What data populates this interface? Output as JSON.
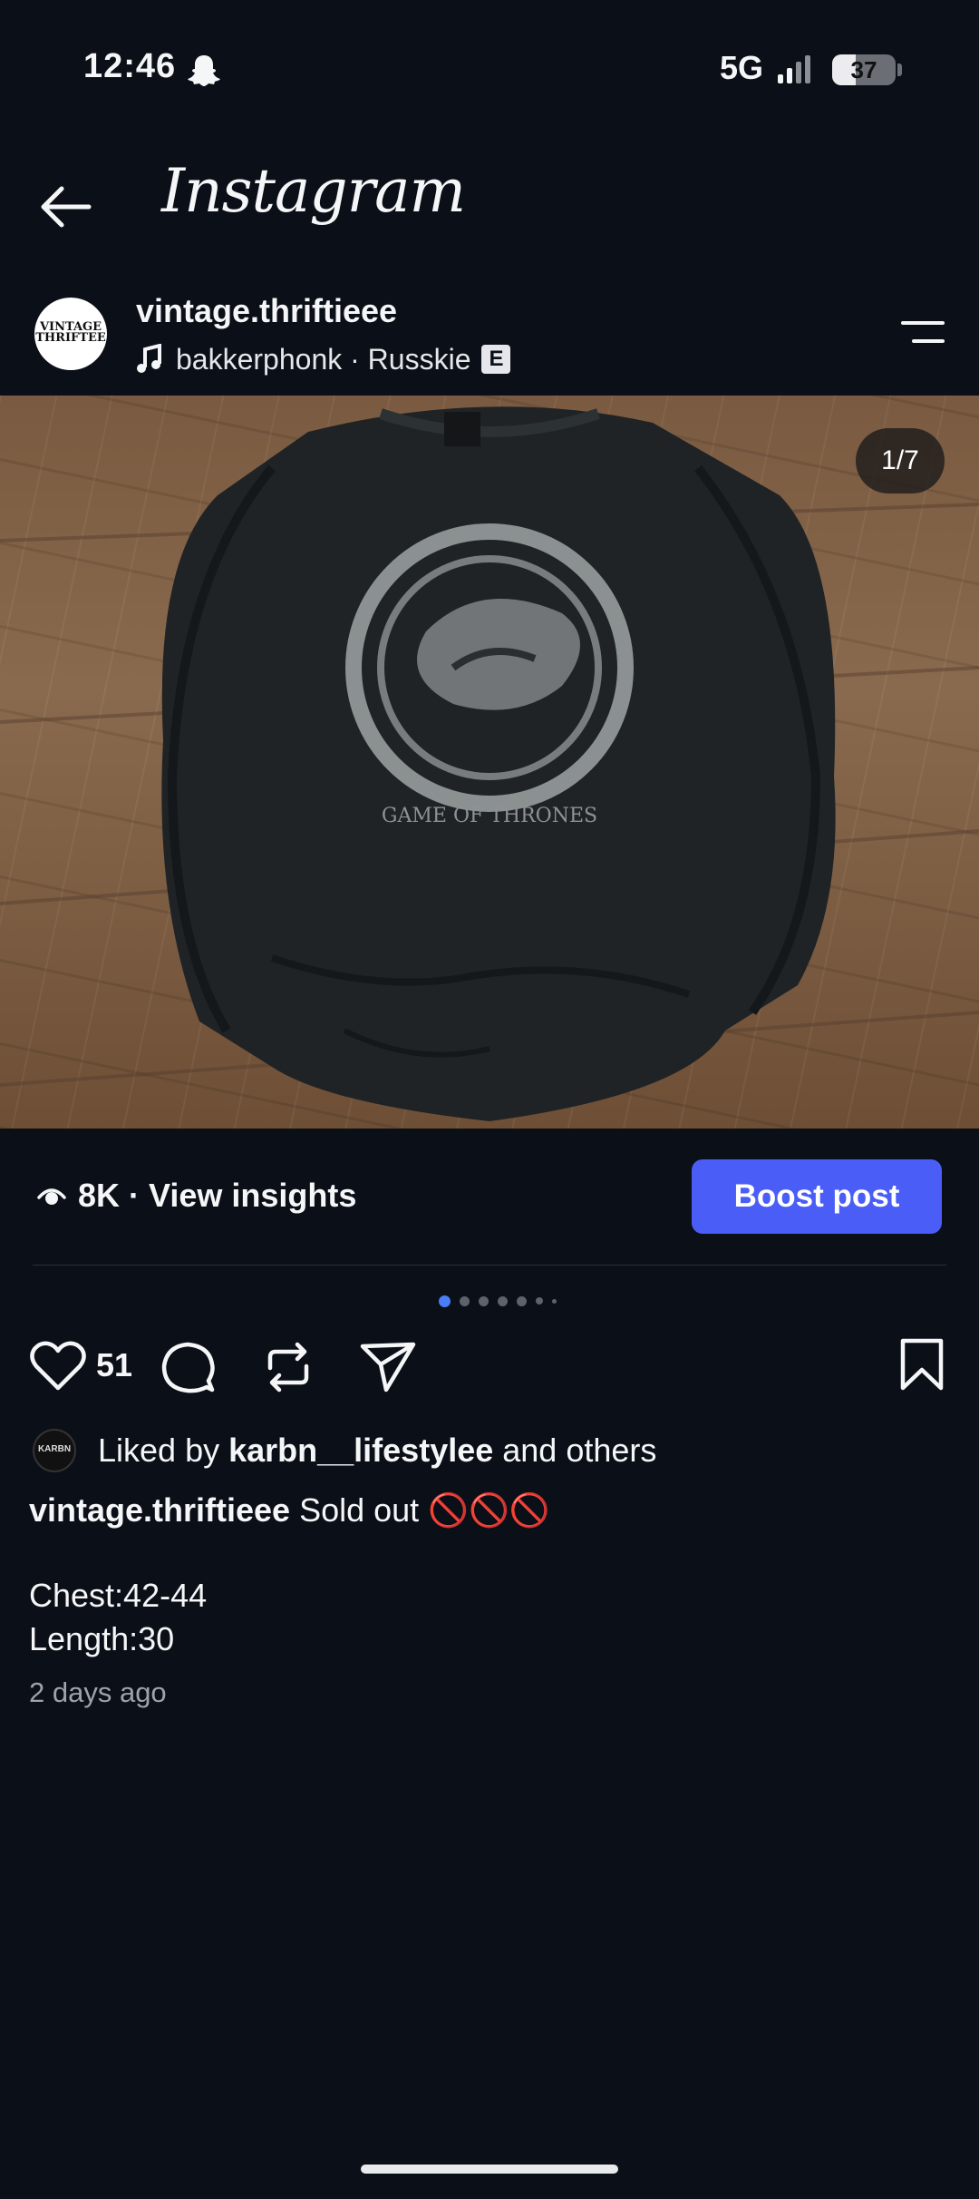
{
  "status_bar": {
    "time": "12:46",
    "network": "5G",
    "battery": "37",
    "battery_level": 0.37
  },
  "header": {
    "app_title": "Instagram",
    "back_icon": "arrow-left-icon"
  },
  "post": {
    "username": "vintage.thriftieee",
    "avatar_text": "VINTAGE THRIFTEE",
    "music_icon": "music-note-icon",
    "music": "bakkerphonk · Russkie",
    "explicit_badge": "E",
    "image_counter": "1/7",
    "shirt_print_text": "GAME OF THRONES",
    "views": "8K · View insights",
    "boost_label": "Boost post",
    "carousel": {
      "total": 7,
      "active": 0
    },
    "like_count": "51",
    "liker_avatar_text": "KARBN",
    "liked_by_prefix": "Liked by ",
    "liked_by_user": "karbn__lifestylee",
    "liked_by_suffix": " and others",
    "caption_user": "vintage.thriftieee",
    "caption_text": " Sold out ",
    "caption_emoji": "🚫🚫🚫",
    "caption_line_chest": "Chest:42-44",
    "caption_line_length": "Length:30",
    "timestamp": "2 days ago"
  },
  "colors": {
    "background": "#0b0f17",
    "accent": "#4a5ef7",
    "active_dot": "#4a7df7"
  }
}
